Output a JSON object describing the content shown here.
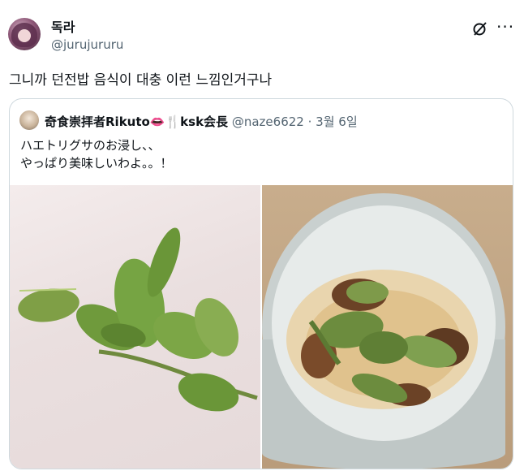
{
  "author": {
    "display_name": "독라",
    "handle": "@jurujururu"
  },
  "tweet": {
    "text": "그니까 던전밥 음식이 대충 이런 느낌인거구나"
  },
  "icons": {
    "grok": "grok-icon",
    "more": "more-icon"
  },
  "quoted_tweet": {
    "display_name": "奇食崇拝者Rikuto👄🍴ksk会長",
    "handle": "@naze6622",
    "separator": "·",
    "date": "3월 6일",
    "text_line_1": "ハエトリグサのお浸し、、",
    "text_line_2": "やっぱり美味しいわよ。。！",
    "images": [
      {
        "subject": "venus-flytrap-plant"
      },
      {
        "subject": "cooked-flytrap-in-bowl"
      }
    ]
  },
  "colors": {
    "text_primary": "#0f1419",
    "text_secondary": "#536471",
    "border": "#cfd9de"
  }
}
